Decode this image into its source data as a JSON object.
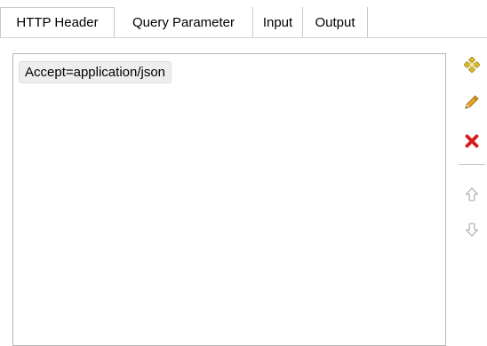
{
  "tabs": [
    {
      "label": "HTTP Header",
      "active": true
    },
    {
      "label": "Query Parameter",
      "active": false
    },
    {
      "label": "Input",
      "active": false
    },
    {
      "label": "Output",
      "active": false
    }
  ],
  "list": {
    "items": [
      {
        "label": "Accept=application/json"
      }
    ]
  },
  "toolbar": {
    "buttons": [
      {
        "icon": "add-icon",
        "enabled": true
      },
      {
        "icon": "pencil-icon",
        "enabled": true
      },
      {
        "icon": "delete-icon",
        "enabled": true
      },
      {
        "icon": "arrow-up-icon",
        "enabled": false
      },
      {
        "icon": "arrow-down-icon",
        "enabled": false
      }
    ]
  },
  "colors": {
    "delete": "#d8191b",
    "pencil": "#e3a72a",
    "add": "#d9ba34",
    "disabled": "#a8a8a8"
  }
}
